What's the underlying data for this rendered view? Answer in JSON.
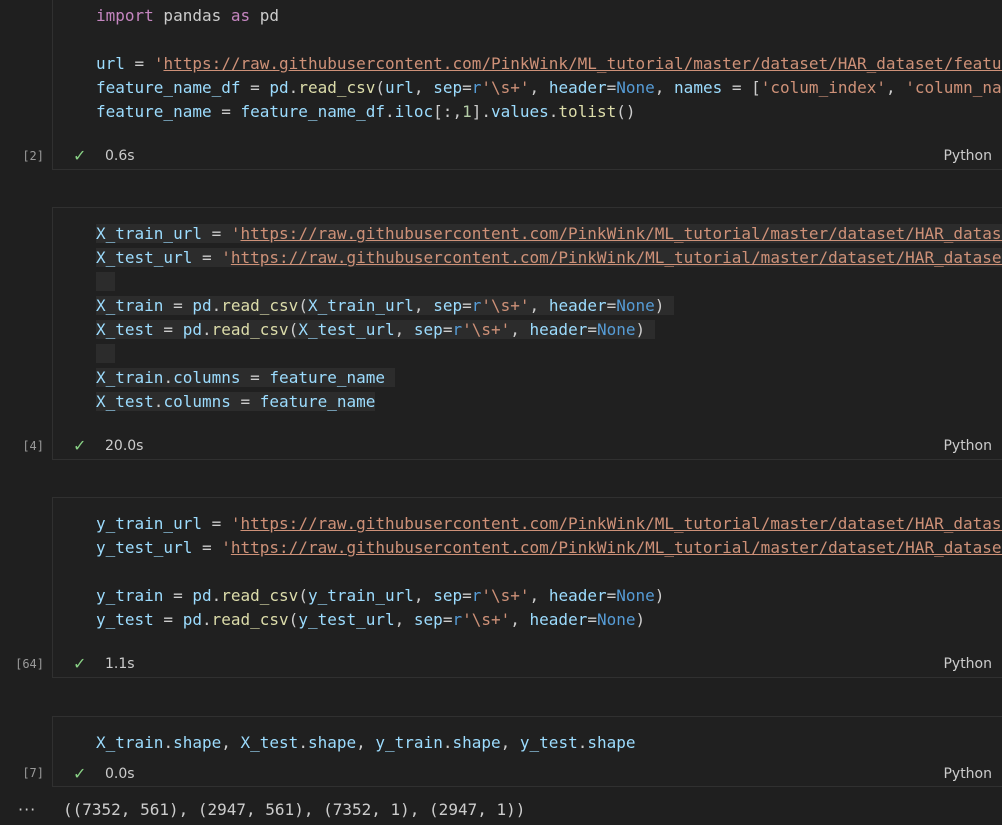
{
  "cells": [
    {
      "exec_count": "[2]",
      "duration": "0.6s",
      "language": "Python",
      "code": {
        "l1_kw": "import",
        "l1_mid": " pandas ",
        "l1_kw2": "as",
        "l1_end": " pd",
        "l2_var": "url",
        "l2_eq": " = ",
        "l2_q": "'",
        "l2_url": "https://raw.githubusercontent.com/PinkWink/ML_tutorial/master/dataset/HAR_dataset/features.txt",
        "l3_var": "feature_name_df",
        "l3_eq": " = ",
        "l3_pd": "pd",
        "l3_dot": ".",
        "l3_fn": "read_csv",
        "l3_p1": "(",
        "l3_arg1": "url",
        "l3_c1": ", ",
        "l3_sep": "sep",
        "l3_eq2": "=",
        "l3_r": "r",
        "l3_str": "'\\s+'",
        "l3_c2": ", ",
        "l3_header": "header",
        "l3_eq3": "=",
        "l3_none": "None",
        "l3_c3": ", ",
        "l3_names": "names",
        "l3_eq4": " = ",
        "l3_br": "[",
        "l3_s1": "'colum_index'",
        "l3_c4": ", ",
        "l3_s2": "'column_name'",
        "l3_end": "])",
        "l4_var": "feature_name",
        "l4_eq": " = ",
        "l4_v2": "feature_name_df",
        "l4_dot": ".",
        "l4_iloc": "iloc",
        "l4_idx": "[:,",
        "l4_num": "1",
        "l4_idx2": "].",
        "l4_values": "values",
        "l4_dot2": ".",
        "l4_fn": "tolist",
        "l4_end": "()"
      }
    },
    {
      "exec_count": "[4]",
      "duration": "20.0s",
      "language": "Python",
      "code": {
        "l1_var": "X_train_url",
        "l1_eq": " = ",
        "l1_q": "'",
        "l1_url": "https://raw.githubusercontent.com/PinkWink/ML_tutorial/master/dataset/HAR_dataset/train/X_train.txt",
        "l2_var": "X_test_url",
        "l2_eq": " = ",
        "l2_q": "'",
        "l2_url": "https://raw.githubusercontent.com/PinkWink/ML_tutorial/master/dataset/HAR_dataset/test/X_test.txt",
        "l3_var": "X_train",
        "l3_eq": " = ",
        "l3_pd": "pd",
        "l3_fn": "read_csv",
        "l3_arg": "X_train_url",
        "l4_var": "X_test",
        "l4_eq": " = ",
        "l4_pd": "pd",
        "l4_fn": "read_csv",
        "l4_arg": "X_test_url",
        "sep": "sep",
        "r": "r",
        "str": "'\\s+'",
        "header": "header",
        "none": "None",
        "l5_var": "X_train",
        "l5_attr": "columns",
        "l5_val": "feature_name",
        "l6_var": "X_test",
        "l6_attr": "columns",
        "l6_val": "feature_name"
      }
    },
    {
      "exec_count": "[64]",
      "duration": "1.1s",
      "language": "Python",
      "code": {
        "l1_var": "y_train_url",
        "l1_eq": " = ",
        "l1_q": "'",
        "l1_url": "https://raw.githubusercontent.com/PinkWink/ML_tutorial/master/dataset/HAR_dataset/train/y_train.txt",
        "l2_var": "y_test_url",
        "l2_eq": " = ",
        "l2_q": "'",
        "l2_url": "https://raw.githubusercontent.com/PinkWink/ML_tutorial/master/dataset/HAR_dataset/test/y_test.txt",
        "l3_var": "y_train",
        "l3_arg": "y_train_url",
        "l4_var": "y_test",
        "l4_arg": "y_test_url",
        "pd": "pd",
        "fn": "read_csv",
        "sep": "sep",
        "r": "r",
        "str": "'\\s+'",
        "header": "header",
        "none": "None"
      }
    },
    {
      "exec_count": "[7]",
      "duration": "0.0s",
      "language": "Python",
      "code": {
        "v1": "X_train",
        "v2": "X_test",
        "v3": "y_train",
        "v4": "y_test",
        "attr": "shape"
      }
    }
  ],
  "output": {
    "more_icon": "···",
    "text": "((7352, 561), (2947, 561), (7352, 1), (2947, 1))"
  },
  "colors": {
    "background": "#1f1f1f",
    "success_check": "#89d185",
    "keyword": "#c586c0",
    "variable": "#9cdcfe",
    "function": "#dcdcaa",
    "string": "#ce9178",
    "builtin": "#569cd6"
  },
  "icons": {
    "success": "check-icon",
    "more": "ellipsis-icon"
  },
  "check_glyph": "✓"
}
